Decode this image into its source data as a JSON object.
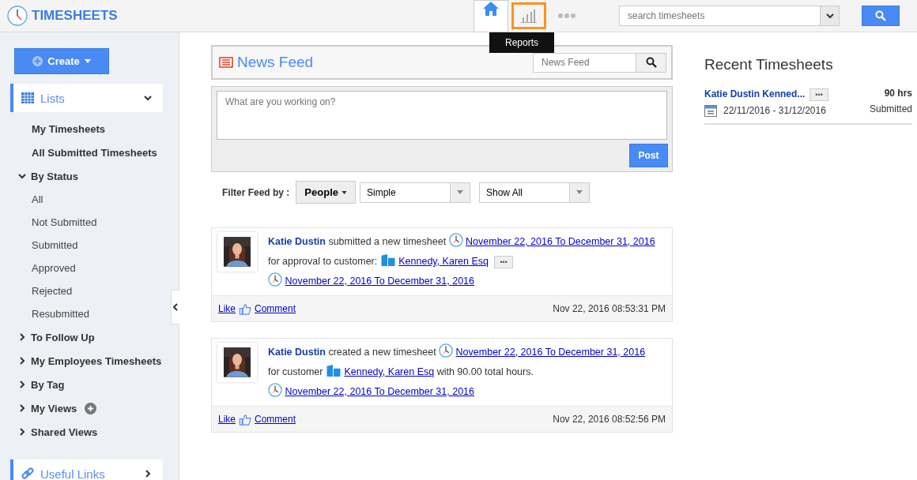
{
  "app": {
    "title": "TIMESHEETS"
  },
  "nav": {
    "items": [
      {
        "kind": "home",
        "selected": true,
        "highlighted": false
      },
      {
        "kind": "reports",
        "selected": false,
        "highlighted": true
      },
      {
        "kind": "more",
        "selected": false,
        "highlighted": false
      }
    ],
    "tooltip": "Reports"
  },
  "search": {
    "placeholder": "search timesheets"
  },
  "sidebar": {
    "create": "Create",
    "lists": {
      "label": "Lists",
      "expanded": true
    },
    "items": [
      {
        "label": "My Timesheets",
        "kind": "link"
      },
      {
        "label": "All Submitted Timesheets",
        "kind": "link"
      },
      {
        "label": "By Status",
        "kind": "group",
        "expanded": true,
        "children": [
          {
            "label": "All"
          },
          {
            "label": "Not Submitted"
          },
          {
            "label": "Submitted"
          },
          {
            "label": "Approved"
          },
          {
            "label": "Rejected"
          },
          {
            "label": "Resubmitted"
          }
        ]
      },
      {
        "label": "To Follow Up",
        "kind": "group",
        "expanded": false
      },
      {
        "label": "My Employees Timesheets",
        "kind": "group",
        "expanded": false
      },
      {
        "label": "By Tag",
        "kind": "group",
        "expanded": false
      },
      {
        "label": "My Views",
        "kind": "group",
        "expanded": false,
        "addable": true
      },
      {
        "label": "Shared Views",
        "kind": "group",
        "expanded": false
      }
    ],
    "useful_links": {
      "label": "Useful Links",
      "expanded": false
    }
  },
  "feed": {
    "title": "News Feed",
    "search_placeholder": "News Feed",
    "composer_placeholder": "What are you working on?",
    "post_button": "Post",
    "filter": {
      "label": "Filter Feed by :",
      "people": "People",
      "type": "Simple",
      "show": "Show All"
    },
    "posts": [
      {
        "parts": [
          {
            "kind": "author",
            "text": "Katie Dustin"
          },
          {
            "kind": "text",
            "text": "submitted a new timesheet"
          },
          {
            "kind": "date",
            "text": "November 22, 2016 To December 31, 2016"
          },
          {
            "kind": "text",
            "text": "for approval to customer:"
          },
          {
            "kind": "customer",
            "text": "Kennedy, Karen Esq"
          },
          {
            "kind": "more",
            "text": "•••"
          }
        ],
        "date_link": "November 22, 2016 To December 31, 2016",
        "like": "Like",
        "comment": "Comment",
        "time": "Nov 22, 2016 08:53:31 PM"
      },
      {
        "parts": [
          {
            "kind": "author",
            "text": "Katie Dustin"
          },
          {
            "kind": "text",
            "text": "created a new timesheet"
          },
          {
            "kind": "date",
            "text": "November 22, 2016 To December 31, 2016"
          },
          {
            "kind": "text",
            "text": "for customer"
          },
          {
            "kind": "customer",
            "text": "Kennedy, Karen Esq"
          },
          {
            "kind": "text",
            "text": "with 90.00 total hours."
          }
        ],
        "date_link": "November 22, 2016 To December 31, 2016",
        "like": "Like",
        "comment": "Comment",
        "time": "Nov 22, 2016 08:52:56 PM"
      }
    ]
  },
  "recent": {
    "title": "Recent Timesheets",
    "items": [
      {
        "name": "Katie Dustin Kenned...",
        "more": "•••",
        "hours": "90 hrs",
        "range": "22/11/2016 - 31/12/2016",
        "status": "Submitted"
      }
    ]
  }
}
